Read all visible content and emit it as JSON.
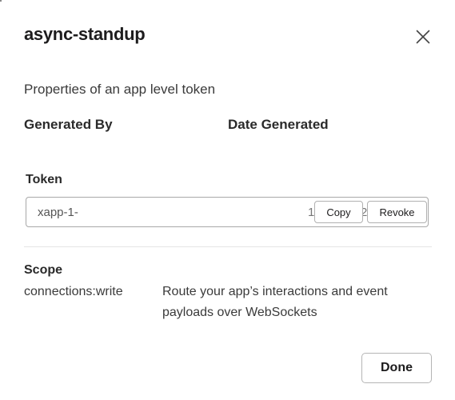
{
  "dialog": {
    "title": "async-standup",
    "subtitle": "Properties of an app level token",
    "columns": {
      "generated_by": "Generated By",
      "date_generated": "Date Generated"
    },
    "close_icon": "close-icon"
  },
  "token": {
    "label": "Token",
    "value_prefix": "xapp-1-",
    "tail_1": "1",
    "tail_2": "2",
    "copy_label": "Copy",
    "revoke_label": "Revoke"
  },
  "scope": {
    "label": "Scope",
    "items": [
      {
        "name": "connections:write",
        "description": "Route your app’s interactions and event payloads over WebSockets"
      }
    ]
  },
  "footer": {
    "done_label": "Done"
  },
  "colors": {
    "text": "#1d1c1d",
    "border": "#a8a8a8",
    "divider": "#e4e4e4",
    "background": "#ffffff"
  }
}
